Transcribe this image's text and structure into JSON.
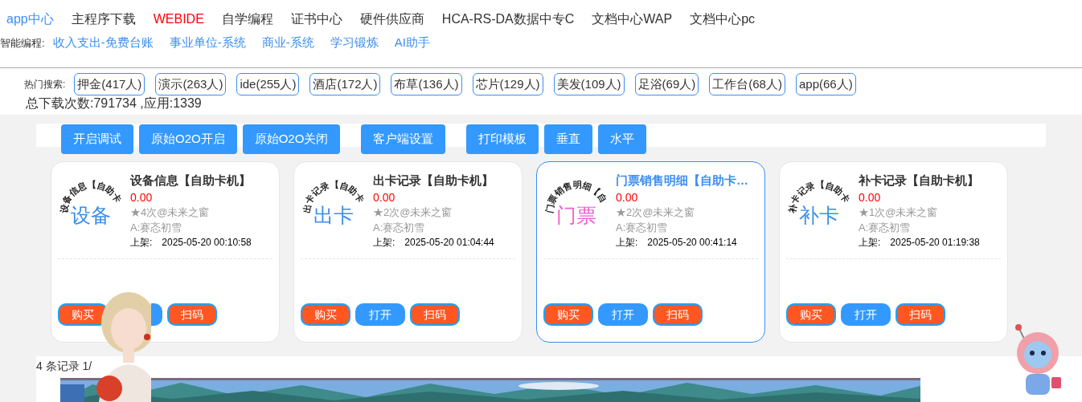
{
  "nav": [
    {
      "label": "app中心",
      "kind": "active"
    },
    {
      "label": "主程序下载",
      "kind": "plain"
    },
    {
      "label": "WEBIDE",
      "kind": "hot"
    },
    {
      "label": "自学编程",
      "kind": "plain"
    },
    {
      "label": "证书中心",
      "kind": "plain"
    },
    {
      "label": "硬件供应商",
      "kind": "plain"
    },
    {
      "label": "HCA-RS-DA数据中专C",
      "kind": "plain"
    },
    {
      "label": "文档中心WAP",
      "kind": "plain"
    },
    {
      "label": "文档中心pc",
      "kind": "plain"
    }
  ],
  "smart": {
    "label": "智能编程:",
    "links": [
      "收入支出-免费台账",
      "事业单位-系统",
      "商业-系统",
      "学习锻炼",
      "AI助手"
    ]
  },
  "hot": {
    "label": "热门搜索:",
    "tags": [
      "押金(417人)",
      "演示(263人)",
      "ide(255人)",
      "酒店(172人)",
      "布草(136人)",
      "芯片(129人)",
      "美发(109人)",
      "足浴(69人)",
      "工作台(68人)",
      "app(66人)"
    ]
  },
  "stats": "总下载次数:791734 ,应用:1339",
  "toolbar": [
    [
      "开启调试",
      "原始O2O开启",
      "原始O2O关闭"
    ],
    [
      "客户端设置"
    ],
    [
      "打印模板",
      "垂直",
      "水平"
    ]
  ],
  "cards": [
    {
      "arc": "设备信息【自助卡",
      "word": "设备",
      "color": "#3b8ee8",
      "title": "设备信息【自助卡机】",
      "price": "0.00",
      "stars": "★4次@未来之窗",
      "author": "A:赛忞初雪",
      "date_label": "上架:",
      "date": "2025-05-20 00:10:58",
      "selected": false,
      "buttons": [
        {
          "kind": "buy",
          "label": "购买"
        },
        {
          "kind": "open"
        },
        {
          "kind": "scan",
          "label": "扫码"
        }
      ]
    },
    {
      "arc": "出卡记录【自助卡",
      "word": "出卡",
      "color": "#3b8ee8",
      "title": "出卡记录【自助卡机】",
      "price": "0.00",
      "stars": "★2次@未来之窗",
      "author": "A:赛忞初雪",
      "date_label": "上架:",
      "date": "2025-05-20 01:04:44",
      "selected": false,
      "buttons": [
        {
          "kind": "buy",
          "label": "购买"
        },
        {
          "kind": "open",
          "label": "打开"
        },
        {
          "kind": "scan",
          "label": "扫码"
        }
      ]
    },
    {
      "arc": "门票销售明细【自",
      "word": "门票",
      "color": "#f05fd0",
      "title": "门票销售明细【自助卡…",
      "price": "0.00",
      "stars": "★2次@未来之窗",
      "author": "A:赛忞初雪",
      "date_label": "上架:",
      "date": "2025-05-20 00:41:14",
      "selected": true,
      "buttons": [
        {
          "kind": "buy",
          "label": "购买"
        },
        {
          "kind": "open",
          "label": "打开"
        },
        {
          "kind": "scan",
          "label": "扫码"
        }
      ]
    },
    {
      "arc": "补卡记录【自助卡",
      "word": "补卡",
      "color": "#3b8ee8",
      "title": "补卡记录【自助卡机】",
      "price": "0.00",
      "stars": "★1次@未来之窗",
      "author": "A:赛忞初雪",
      "date_label": "上架:",
      "date": "2025-05-20 01:19:38",
      "selected": false,
      "buttons": [
        {
          "kind": "buy",
          "label": "购买"
        },
        {
          "kind": "open",
          "label": "打开"
        },
        {
          "kind": "scan",
          "label": "扫码"
        }
      ]
    }
  ],
  "footer": {
    "records": "4 条记录 1/"
  }
}
